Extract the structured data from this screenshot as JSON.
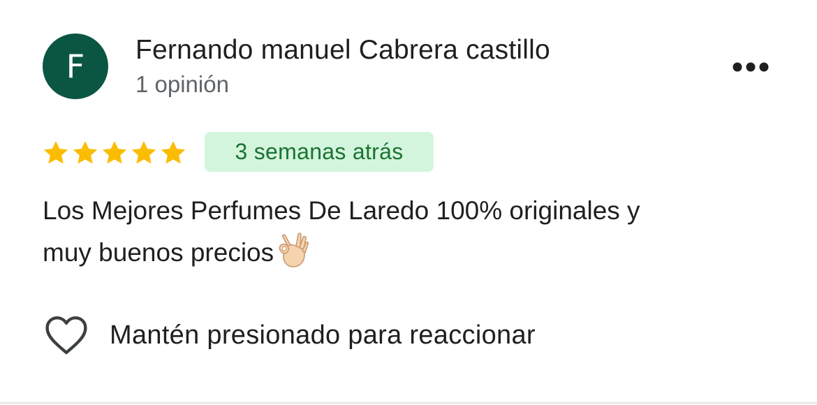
{
  "review": {
    "avatar_initial": "F",
    "avatar_color": "#0b5543",
    "reviewer_name": "Fernando manuel Cabrera castillo",
    "review_count": "1 opinión",
    "more_icon": "more-horizontal-icon",
    "rating": 5,
    "rating_max": 5,
    "star_color": "#fbbc04",
    "date": "3 semanas atrás",
    "date_badge_bg": "#d4f5dd",
    "date_badge_text_color": "#1b7332",
    "text_line1": "Los Mejores Perfumes De Laredo 100% originales y",
    "text_line2": "muy buenos precios",
    "emoji_icon": "ok-hand-icon"
  },
  "reaction": {
    "icon": "heart-outline-icon",
    "label": "Mantén presionado para reaccionar"
  }
}
